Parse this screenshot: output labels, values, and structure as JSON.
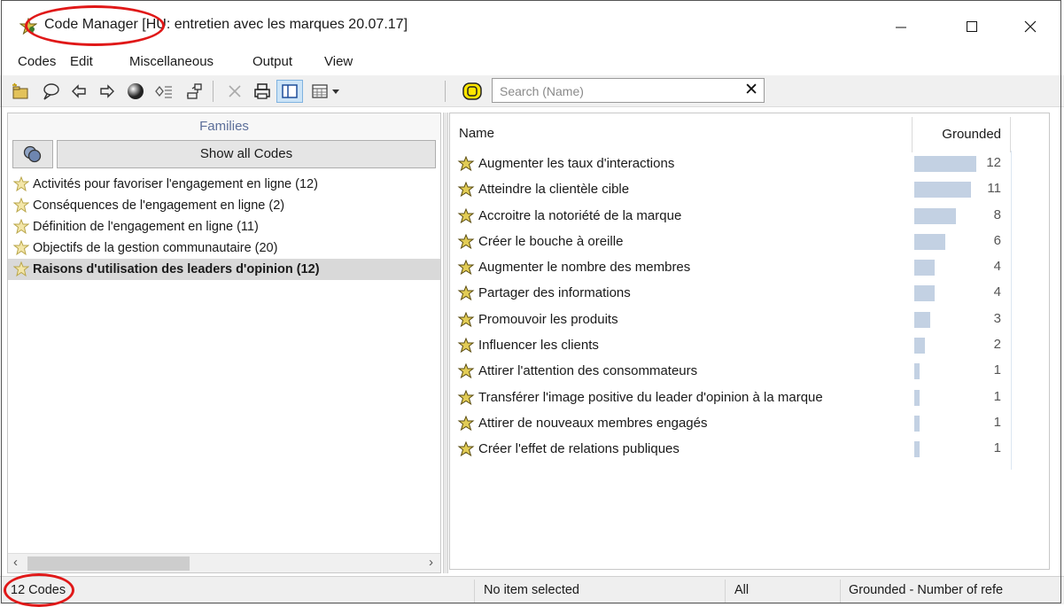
{
  "window": {
    "title_app": "Code Manager",
    "title_doc": "[HU: entretien avec les marques 20.07.17]",
    "minimize_icon": "minimize-icon",
    "maximize_icon": "maximize-icon",
    "close_icon": "close-icon"
  },
  "menu": [
    "Codes",
    "Edit",
    "Miscellaneous",
    "Output",
    "View"
  ],
  "toolbar": {
    "buttons": [
      "new-code-icon",
      "comment-icon",
      "back-arrow-icon",
      "forward-arrow-icon",
      "color-sphere-icon",
      "network-icon",
      "tree-icon",
      "delete-icon",
      "print-icon",
      "split-view-icon",
      "table-view-icon",
      "filter-icon"
    ],
    "search_placeholder": "Search (Name)",
    "search_clear": "✕"
  },
  "families": {
    "header": "Families",
    "show_all": "Show all Codes",
    "items": [
      {
        "label": "Activités pour favoriser l'engagement en ligne (12)",
        "selected": false
      },
      {
        "label": "Conséquences de l'engagement en ligne (2)",
        "selected": false
      },
      {
        "label": "Définition de l'engagement en ligne (11)",
        "selected": false
      },
      {
        "label": "Objectifs de la gestion communautaire (20)",
        "selected": false
      },
      {
        "label": "Raisons d'utilisation des leaders d'opinion (12)",
        "selected": true
      }
    ]
  },
  "codes_table": {
    "columns": [
      "Name",
      "Grounded"
    ],
    "rows": [
      {
        "name": "Augmenter les taux d'interactions",
        "grounded": 12
      },
      {
        "name": "Atteindre la clientèle cible",
        "grounded": 11
      },
      {
        "name": "Accroitre la notoriété de la marque",
        "grounded": 8
      },
      {
        "name": "Créer le bouche à oreille",
        "grounded": 6
      },
      {
        "name": "Augmenter le nombre des membres",
        "grounded": 4
      },
      {
        "name": "Partager des informations",
        "grounded": 4
      },
      {
        "name": "Promouvoir les produits",
        "grounded": 3
      },
      {
        "name": "Influencer les clients",
        "grounded": 2
      },
      {
        "name": "Attirer l'attention des consommateurs",
        "grounded": 1
      },
      {
        "name": "Transférer l'image positive du leader d'opinion à la marque",
        "grounded": 1
      },
      {
        "name": "Attirer de nouveaux membres engagés",
        "grounded": 1
      },
      {
        "name": "Créer l'effet de relations publiques",
        "grounded": 1
      }
    ]
  },
  "status": {
    "count": "12 Codes",
    "selection": "No item selected",
    "filter": "All",
    "sort": "Grounded - Number of refe"
  },
  "colors": {
    "annotation": "#e01818",
    "grounded_bar": "#c3d1e3",
    "families_header": "#5c6f9a",
    "selected_row": "#d9d9d9"
  }
}
